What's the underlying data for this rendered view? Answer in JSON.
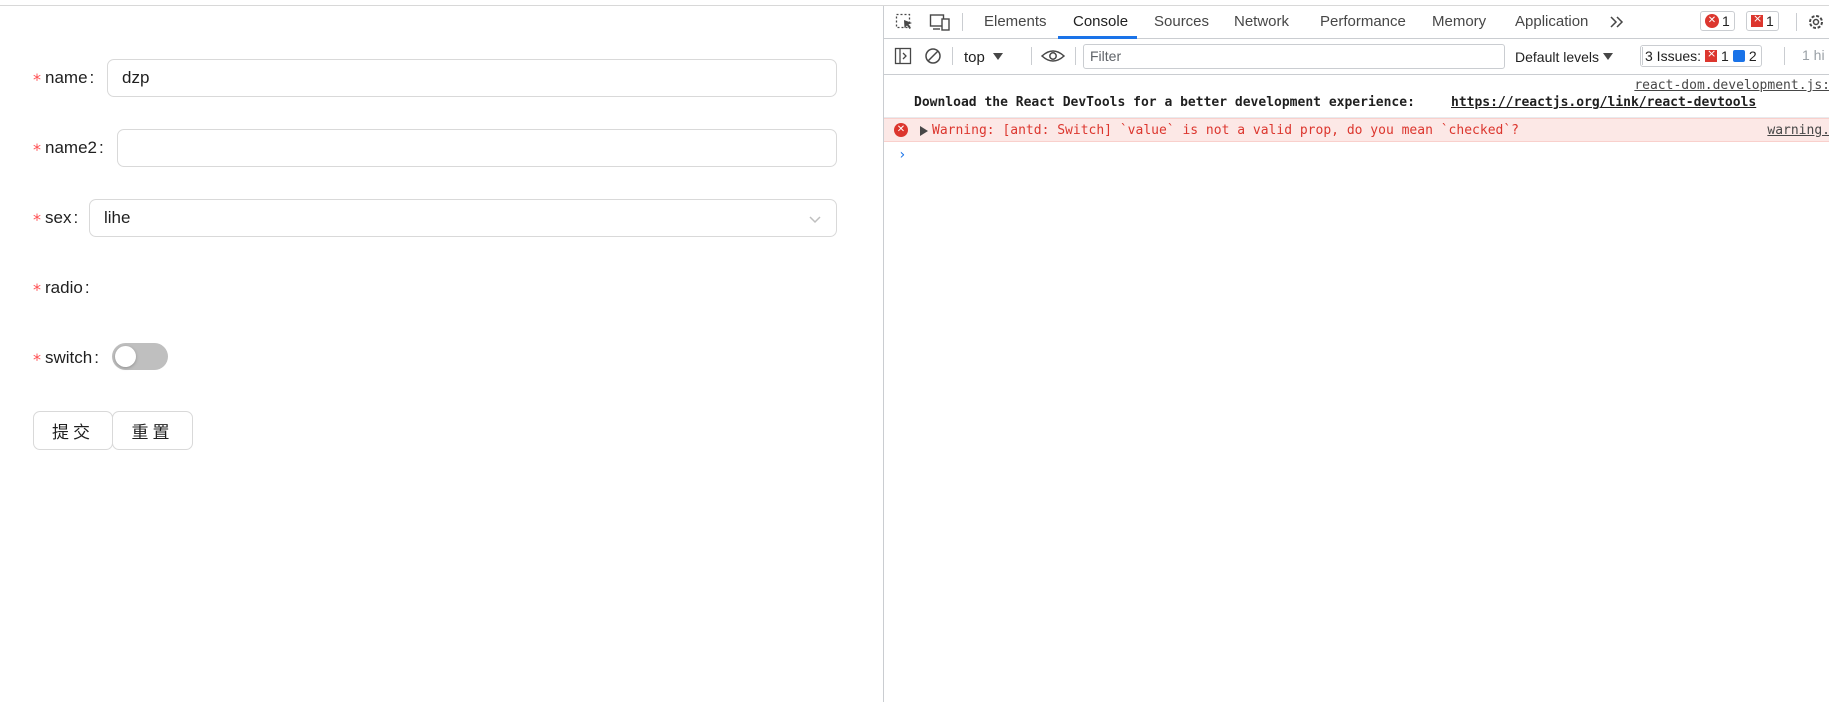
{
  "form": {
    "fields": [
      {
        "label": "name",
        "colon": ":",
        "value": "dzp"
      },
      {
        "label": "name2",
        "colon": ":",
        "value": ""
      },
      {
        "label": "sex",
        "colon": ":",
        "value": "lihe"
      },
      {
        "label": "radio",
        "colon": ":"
      },
      {
        "label": "switch",
        "colon": ":",
        "checked": false
      }
    ],
    "required_mark": "*",
    "buttons": {
      "submit": "提交",
      "reset": "重置"
    }
  },
  "devtools": {
    "tabs": [
      "Elements",
      "Console",
      "Sources",
      "Network",
      "Performance",
      "Memory",
      "Application"
    ],
    "active_tab": "Console",
    "error_count": "1",
    "issue_flag_count": "1",
    "context": "top",
    "filter_placeholder": "Filter",
    "levels": "Default levels",
    "issues_label": "3 Issues:",
    "issues_errors": "1",
    "issues_info": "2",
    "hidden": "1 hi",
    "messages": [
      {
        "type": "info",
        "source": "react-dom.development.js:",
        "text": "Download the React DevTools for a better development experience: ",
        "link": "https://reactjs.org/link/react-devtools"
      },
      {
        "type": "error",
        "text": "Warning: [antd: Switch] `value` is not a valid prop, do you mean `checked`?",
        "source": "warning."
      }
    ],
    "prompt": "›"
  },
  "colors": {
    "required": "#ff4d4f",
    "accent": "#1a73e8",
    "error": "#dc362e",
    "error_bg": "#fce8e6"
  }
}
